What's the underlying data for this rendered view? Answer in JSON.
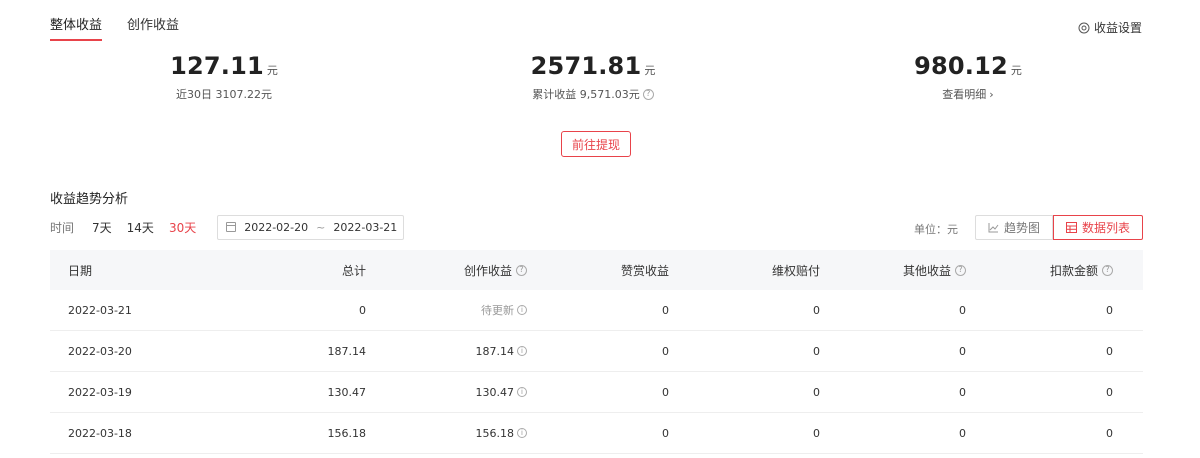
{
  "tabs": [
    {
      "label": "整体收益",
      "active": true
    },
    {
      "label": "创作收益",
      "active": false
    }
  ],
  "settings_label": "收益设置",
  "stats": [
    {
      "value": "127.11",
      "unit": "元",
      "sub": "近30日 3107.22元"
    },
    {
      "value": "2571.81",
      "unit": "元",
      "sub": "累计收益 9,571.03元"
    },
    {
      "value": "980.12",
      "unit": "元",
      "sub": "查看明细"
    }
  ],
  "withdraw_label": "前往提现",
  "section_title": "收益趋势分析",
  "time_filter": {
    "label": "时间",
    "ranges": [
      "7天",
      "14天",
      "30天"
    ],
    "active": "30天",
    "start_date": "2022-02-20",
    "separator": "~",
    "end_date": "2022-03-21"
  },
  "unit_text": "单位：元",
  "view_toggle": {
    "chart_label": "趋势图",
    "list_label": "数据列表",
    "active": "list"
  },
  "table": {
    "headers": [
      "日期",
      "总计",
      "创作收益",
      "赞赏收益",
      "维权赔付",
      "其他收益",
      "扣款金额"
    ],
    "rows": [
      [
        "2022-03-21",
        "0",
        "待更新",
        "0",
        "0",
        "0",
        "0"
      ],
      [
        "2022-03-20",
        "187.14",
        "187.14",
        "0",
        "0",
        "0",
        "0"
      ],
      [
        "2022-03-19",
        "130.47",
        "130.47",
        "0",
        "0",
        "0",
        "0"
      ],
      [
        "2022-03-18",
        "156.18",
        "156.18",
        "0",
        "0",
        "0",
        "0"
      ]
    ]
  },
  "colors": {
    "accent": "#e8434a",
    "header_bg": "#f6f7f9"
  }
}
